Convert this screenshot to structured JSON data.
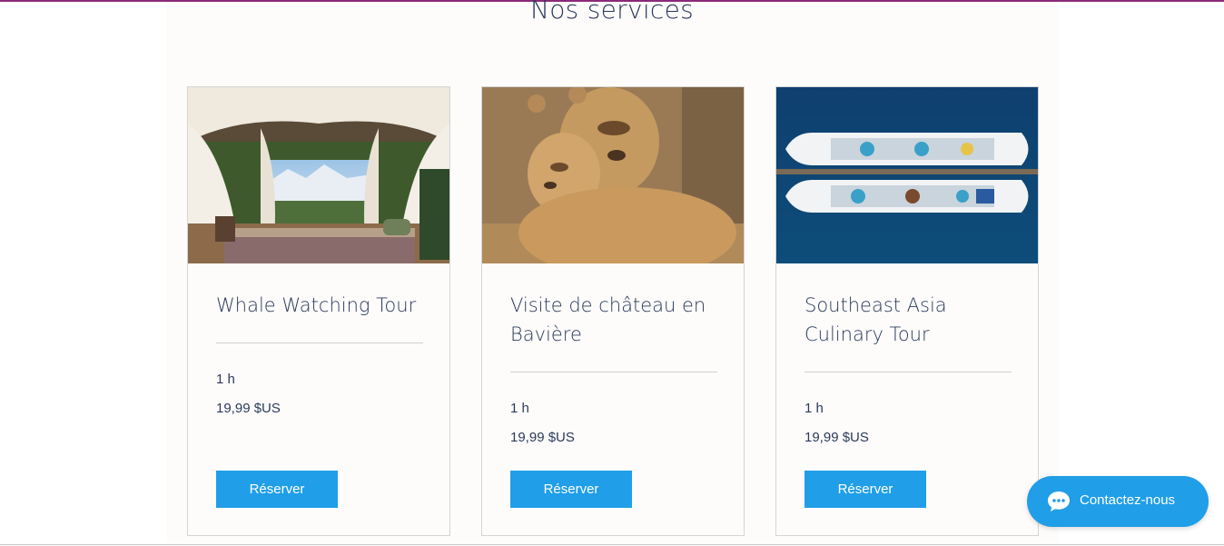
{
  "section": {
    "title": "Nos services"
  },
  "services": [
    {
      "title": "Whale Watching Tour",
      "duration": "1 h",
      "price": "19,99 $US",
      "button_label": "Réserver",
      "image": "glamping-tent-photo"
    },
    {
      "title": "Visite de château en Bavière",
      "duration": "1 h",
      "price": "19,99 $US",
      "button_label": "Réserver",
      "image": "lions-photo"
    },
    {
      "title": "Southeast Asia Culinary Tour",
      "duration": "1 h",
      "price": "19,99 $US",
      "button_label": "Réserver",
      "image": "cruise-ships-aerial-photo"
    }
  ],
  "chat": {
    "label": "Contactez-nous",
    "icon": "chat-bubble-icon"
  },
  "colors": {
    "accent": "#209ee8",
    "text": "#2b3a5a",
    "top_border": "#8a2a7a"
  }
}
